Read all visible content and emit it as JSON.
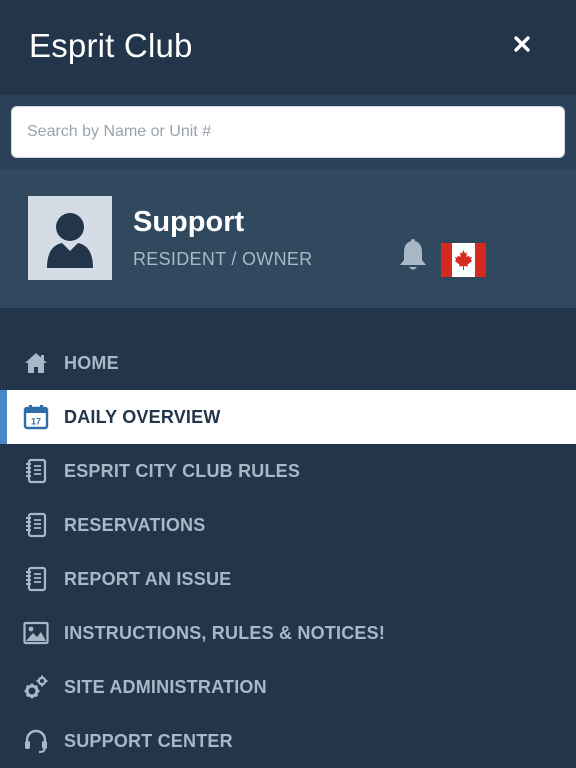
{
  "header": {
    "title": "Esprit Club",
    "close_icon": "close-icon"
  },
  "search": {
    "placeholder": "Search by Name or Unit #",
    "value": ""
  },
  "profile": {
    "name": "Support",
    "role": "RESIDENT / OWNER",
    "avatar_icon": "user-avatar-icon",
    "notification_icon": "bell-icon",
    "flag_icon": "canada-flag-icon"
  },
  "menu": {
    "items": [
      {
        "label": "HOME",
        "icon": "home-icon"
      },
      {
        "label": "DAILY OVERVIEW",
        "icon": "calendar-icon",
        "calendar_day": "17",
        "active": true
      },
      {
        "label": "ESPRIT CITY CLUB RULES",
        "icon": "notebook-icon"
      },
      {
        "label": "RESERVATIONS",
        "icon": "notebook-icon"
      },
      {
        "label": "REPORT AN ISSUE",
        "icon": "notebook-icon"
      },
      {
        "label": "INSTRUCTIONS, RULES & NOTICES!",
        "icon": "image-icon"
      },
      {
        "label": "SITE ADMINISTRATION",
        "icon": "gears-icon"
      },
      {
        "label": "SUPPORT CENTER",
        "icon": "headset-icon"
      }
    ]
  },
  "colors": {
    "background": "#22354a",
    "search_band": "#2b4158",
    "profile_band": "#30495f",
    "menu_text": "#a9b8c6",
    "active_bg": "#ffffff",
    "active_accent": "#4a86c5",
    "flag_red": "#d52b1e"
  }
}
